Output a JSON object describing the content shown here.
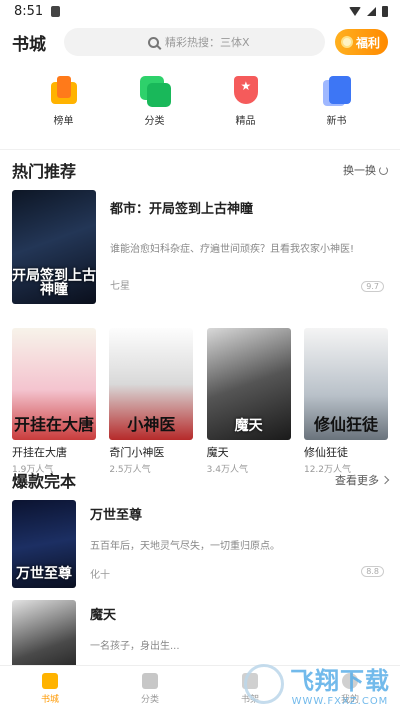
{
  "status_bar": {
    "time": "8:51"
  },
  "header": {
    "title": "书城",
    "search_placeholder": "精彩热搜：三体X",
    "welfare_label": "福利"
  },
  "categories": [
    {
      "label": "榜单",
      "icon": "ranking-icon"
    },
    {
      "label": "分类",
      "icon": "category-icon"
    },
    {
      "label": "精品",
      "icon": "premium-icon"
    },
    {
      "label": "新书",
      "icon": "new-book-icon"
    }
  ],
  "hot": {
    "title": "热门推荐",
    "action": "换一换",
    "featured": {
      "cover_text": "开局签到上古神瞳",
      "title": "都市：开局签到上古神瞳",
      "desc": "谁能治愈妇科杂症、疗遍世间顽疾？且看我农家小神医!",
      "author": "七星",
      "score": "9.7"
    },
    "grid": [
      {
        "name": "开挂在大唐",
        "pop": "1.9万人气",
        "cover_text": "开挂在大唐"
      },
      {
        "name": "奇门小神医",
        "pop": "2.5万人气",
        "cover_text": "小神医"
      },
      {
        "name": "魔天",
        "pop": "3.4万人气",
        "cover_text": "魔天"
      },
      {
        "name": "修仙狂徒",
        "pop": "12.2万人气",
        "cover_text": "修仙狂徒"
      }
    ]
  },
  "completed": {
    "title": "爆款完本",
    "action": "查看更多",
    "items": [
      {
        "title": "万世至尊",
        "desc": "五百年后，天地灵气尽失，一切重归原点。",
        "author": "化十",
        "score": "8.8",
        "cover_text": "万世至尊"
      },
      {
        "title": "魔天",
        "desc": "一名孩子，身出生...",
        "author": "",
        "score": "",
        "cover_text": ""
      }
    ]
  },
  "bottom_nav": [
    {
      "label": "书城",
      "active": true
    },
    {
      "label": "分类",
      "active": false
    },
    {
      "label": "书架",
      "active": false
    },
    {
      "label": "我的",
      "active": false
    }
  ],
  "watermark": {
    "cn": "飞翔下载",
    "en": "WWW.FXXZ.COM"
  }
}
